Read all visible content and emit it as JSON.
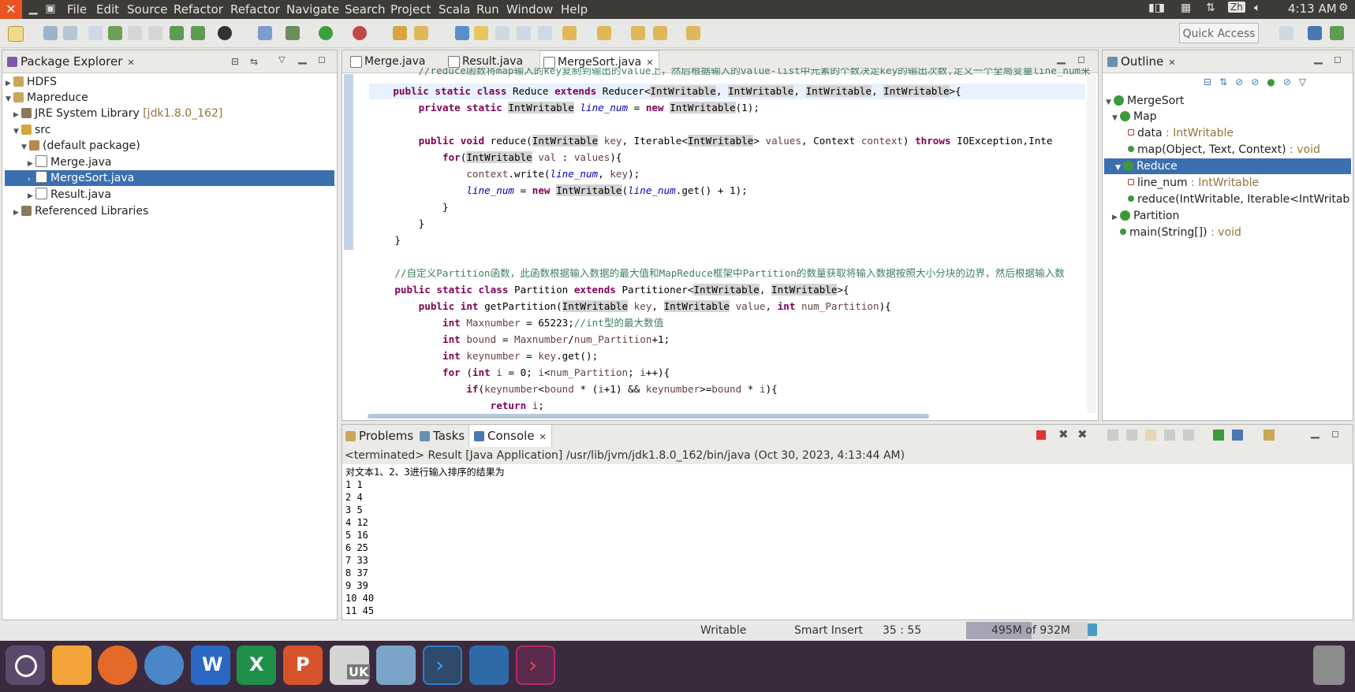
{
  "menubar": {
    "items": [
      "File",
      "Edit",
      "Source",
      "Refactor",
      "Refactor",
      "Navigate",
      "Search",
      "Project",
      "Scala",
      "Run",
      "Window",
      "Help"
    ],
    "time": "4:13 AM",
    "ime": "Zh"
  },
  "toolbar": {
    "quick_access": "Quick Access"
  },
  "package_explorer": {
    "title": "Package Explorer",
    "items": {
      "hdfs": "HDFS",
      "mapreduce": "Mapreduce",
      "jre": "JRE System Library",
      "jre_version": "[jdk1.8.0_162]",
      "src": "src",
      "default_pkg": "(default package)",
      "merge": "Merge.java",
      "mergesort": "MergeSort.java",
      "result": "Result.java",
      "reflibs": "Referenced Libraries"
    }
  },
  "editor": {
    "tabs": [
      "Merge.java",
      "Result.java",
      "MergeSort.java"
    ]
  },
  "outline": {
    "title": "Outline",
    "items": {
      "root": "MergeSort",
      "map": "Map",
      "data": "data",
      "data_type": ": IntWritable",
      "map_method": "map(Object, Text, Context)",
      "map_ret": ": void",
      "reduce": "Reduce",
      "line_num": "line_num",
      "line_num_type": ": IntWritable",
      "reduce_method": "reduce(IntWritable, Iterable<IntWritab",
      "partition": "Partition",
      "main": "main(String[])",
      "main_ret": ": void"
    }
  },
  "bottom": {
    "tabs": [
      "Problems",
      "Tasks",
      "Console"
    ],
    "terminated": "<terminated> Result [Java Application] /usr/lib/jvm/jdk1.8.0_162/bin/java (Oct 30, 2023, 4:13:44 AM)",
    "output": [
      "对文本1、2、3进行输入排序的结果为",
      "1 1",
      "2 4",
      "3 5",
      "4 12",
      "5 16",
      "6 25",
      "7 33",
      "8 37",
      "9 39",
      "10 40",
      "11 45"
    ]
  },
  "status": {
    "writable": "Writable",
    "insert": "Smart Insert",
    "position": "35 : 55",
    "memory": "495M of 932M"
  },
  "colors": {
    "accent_selection": "#3c6fb0",
    "ubuntu_orange": "#e95420",
    "dock_bg": "#3b2a3e"
  }
}
